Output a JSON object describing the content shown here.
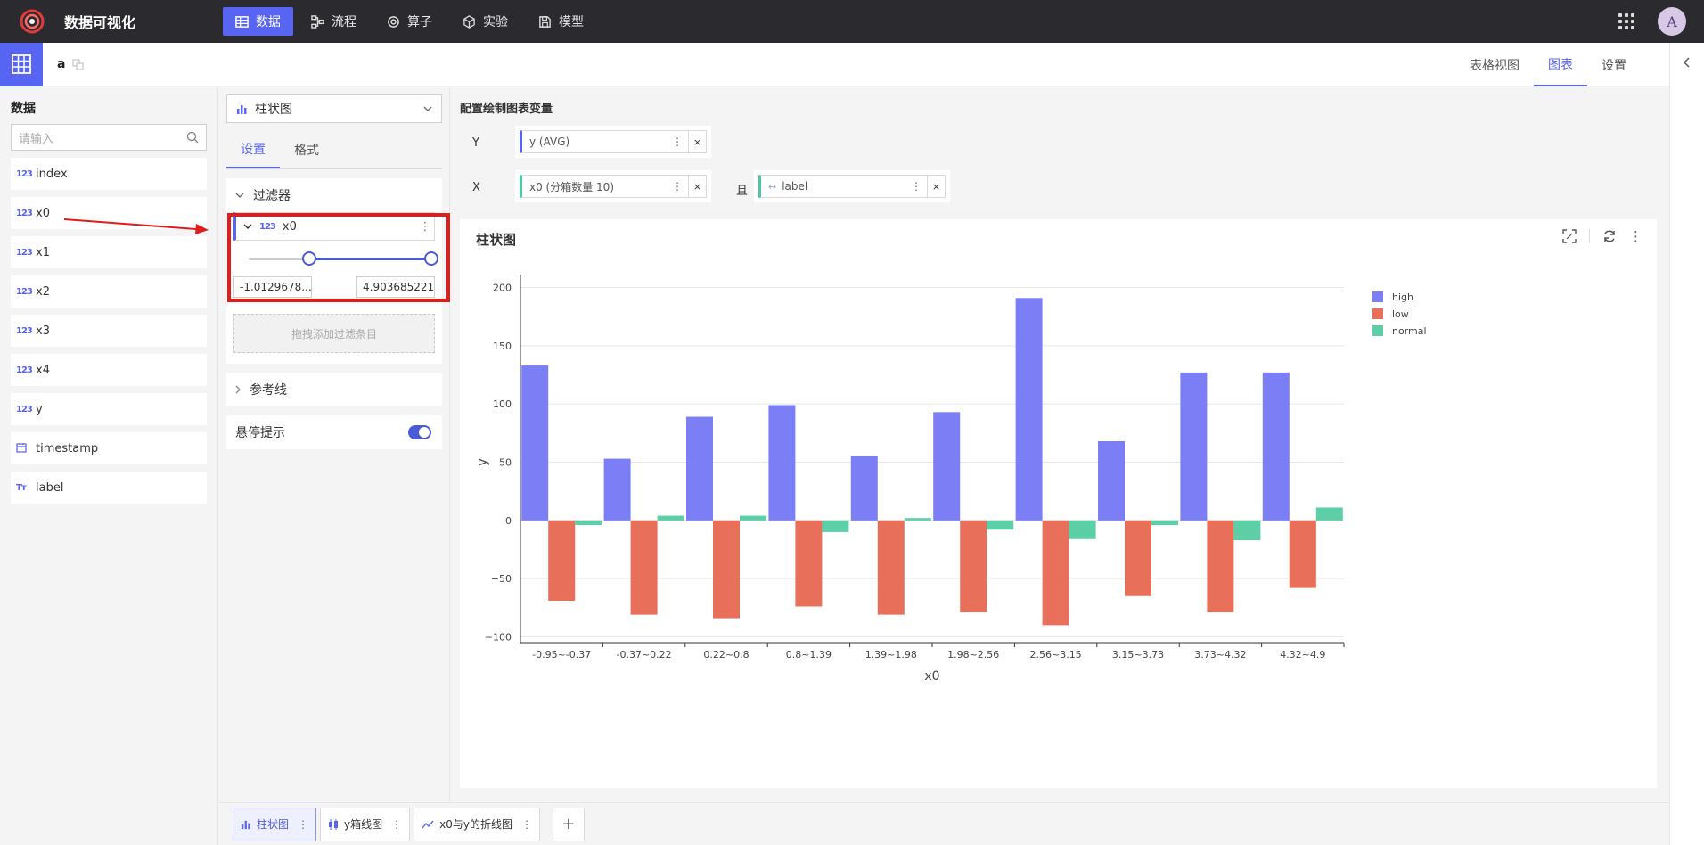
{
  "app": {
    "title": "数据可视化"
  },
  "nav": [
    {
      "label": "数据",
      "icon": "table-icon",
      "active": true
    },
    {
      "label": "流程",
      "icon": "flow-icon",
      "active": false
    },
    {
      "label": "算子",
      "icon": "operator-icon",
      "active": false
    },
    {
      "label": "实验",
      "icon": "cube-icon",
      "active": false
    },
    {
      "label": "模型",
      "icon": "save-icon",
      "active": false
    }
  ],
  "user": {
    "avatar_letter": "A"
  },
  "dataset": {
    "name": "a"
  },
  "view_tabs": [
    {
      "label": "表格视图",
      "active": false
    },
    {
      "label": "图表",
      "active": true
    },
    {
      "label": "设置",
      "active": false
    }
  ],
  "left_panel": {
    "title": "数据",
    "search_placeholder": "请输入",
    "variables": [
      {
        "name": "index",
        "type": "123"
      },
      {
        "name": "x0",
        "type": "123"
      },
      {
        "name": "x1",
        "type": "123"
      },
      {
        "name": "x2",
        "type": "123"
      },
      {
        "name": "x3",
        "type": "123"
      },
      {
        "name": "x4",
        "type": "123"
      },
      {
        "name": "y",
        "type": "123"
      },
      {
        "name": "timestamp",
        "type": "date"
      },
      {
        "name": "label",
        "type": "Tт"
      }
    ]
  },
  "mid_panel": {
    "chart_type": "柱状图",
    "tabs": [
      {
        "label": "设置",
        "active": true
      },
      {
        "label": "格式",
        "active": false
      }
    ],
    "filter_section": "过滤器",
    "filter": {
      "field": "x0",
      "type_badge": "123",
      "min": "-1.0129678...",
      "max": "4.903685221",
      "range_low": 0.33,
      "range_high": 1.0
    },
    "drop_hint": "拖拽添加过滤条目",
    "reference_section": "参考线",
    "tooltip_label": "悬停提示",
    "tooltip_on": true
  },
  "config": {
    "title": "配置绘制图表变量",
    "y_label": "Y",
    "y_field": "y (AVG)",
    "x_label": "X",
    "x_field": "x0 (分箱数量 10)",
    "and_label": "且",
    "color_field": "label",
    "remove": "×"
  },
  "chart_title": "柱状图",
  "chart_data": {
    "type": "bar",
    "categories": [
      "-0.95~-0.37",
      "-0.37~0.22",
      "0.22~0.8",
      "0.8~1.39",
      "1.39~1.98",
      "1.98~2.56",
      "2.56~3.15",
      "3.15~3.73",
      "3.73~4.32",
      "4.32~4.9"
    ],
    "series": [
      {
        "name": "high",
        "color": "#7b7ef5",
        "values": [
          133,
          53,
          89,
          99,
          55,
          93,
          191,
          68,
          127,
          127
        ]
      },
      {
        "name": "low",
        "color": "#e8705a",
        "values": [
          -69,
          -81,
          -84,
          -74,
          -81,
          -79,
          -90,
          -65,
          -79,
          -58
        ]
      },
      {
        "name": "normal",
        "color": "#5ccfa6",
        "values": [
          -4,
          4,
          4,
          -10,
          2,
          -8,
          -16,
          -4,
          -17,
          11
        ]
      }
    ],
    "xlabel": "x0",
    "ylabel": "y",
    "ylim": [
      -105,
      205
    ],
    "yticks": [
      "200",
      "150",
      "100",
      "50",
      "0",
      "−50",
      "−100"
    ],
    "grid": true,
    "legend_position": "top-right"
  },
  "bottom_tabs": [
    {
      "label": "柱状图",
      "active": true,
      "icon": "bar-chart-icon"
    },
    {
      "label": "y箱线图",
      "active": false,
      "icon": "boxplot-icon"
    },
    {
      "label": "x0与y的折线图",
      "active": false,
      "icon": "line-chart-icon"
    }
  ],
  "add_tab": "+"
}
